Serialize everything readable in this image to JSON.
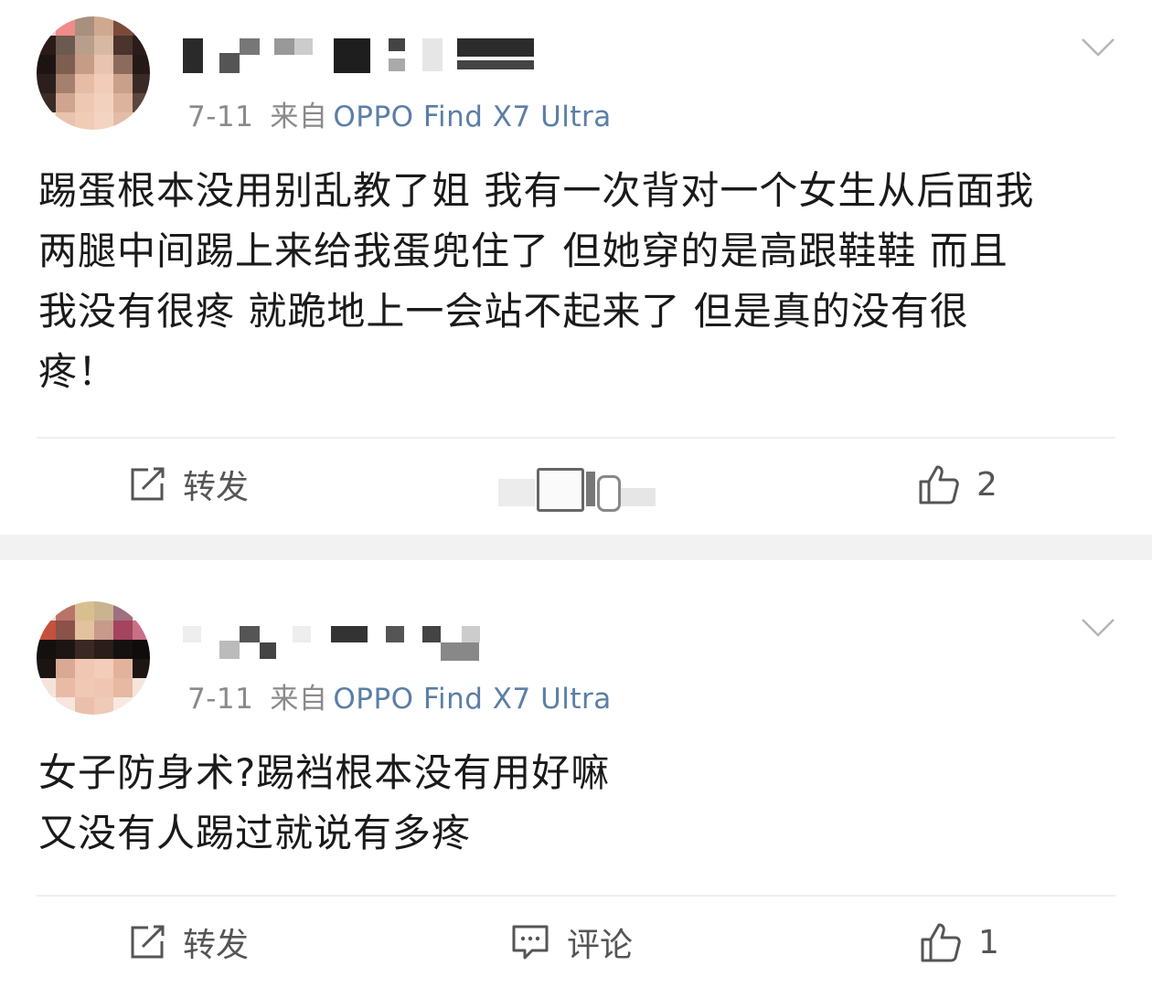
{
  "posts": [
    {
      "date": "7-11",
      "from": "来自",
      "source": "OPPO Find X7 Ultra",
      "content_lines": [
        "踢蛋根本没用别乱教了姐 我有一次背对一个女生从后面我",
        "两腿中间踢上来给我蛋兜住了 但她穿的是高跟鞋鞋 而且",
        "我没有很疼 就跪地上一会站不起来了 但是真的没有很",
        "疼！"
      ],
      "actions": {
        "repost_label": "转发",
        "like_count": "2"
      },
      "icons": [
        "avatar",
        "chevron-down-icon",
        "repost-icon",
        "like-icon"
      ]
    },
    {
      "date": "7-11",
      "from": "来自",
      "source": "OPPO Find X7 Ultra",
      "content_lines": [
        "女子防身术?踢裆根本没有用好嘛",
        "又没有人踢过就说有多疼"
      ],
      "actions": {
        "repost_label": "转发",
        "comment_label": "评论",
        "like_count": "1"
      },
      "icons": [
        "avatar",
        "chevron-down-icon",
        "repost-icon",
        "comment-icon",
        "like-icon"
      ]
    }
  ],
  "colors": {
    "text": "#1a1a1a",
    "meta": "#8a8a8a",
    "source_link": "#5b7fa6",
    "separator": "#f2f2f2"
  }
}
